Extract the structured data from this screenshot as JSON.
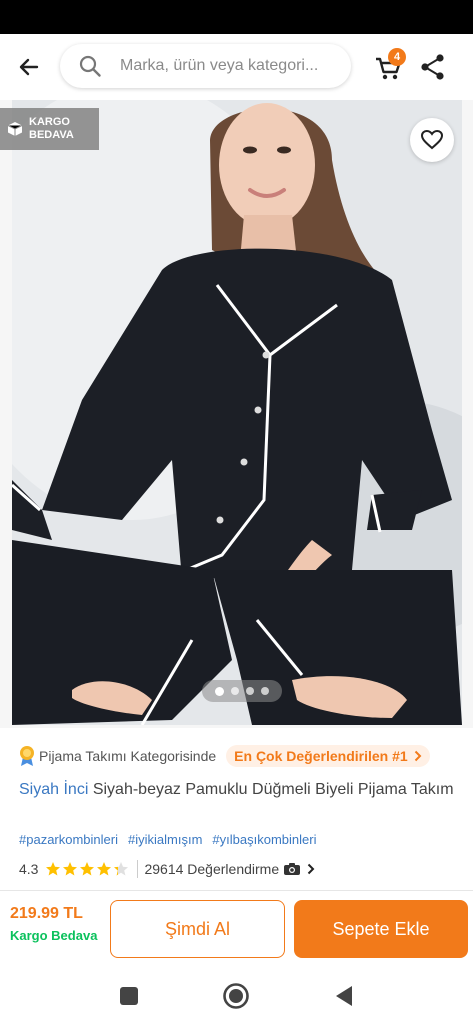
{
  "header": {
    "search_placeholder": "Marka, ürün veya kategori...",
    "cart_count": "4"
  },
  "badge": {
    "line1": "KARGO",
    "line2": "BEDAVA"
  },
  "gallery": {
    "image_count": 4,
    "active_index": 0
  },
  "category": {
    "label": "Pijama Takımı Kategorisinde",
    "rank": "En Çok Değerlendirilen #1"
  },
  "product": {
    "brand": "Siyah İnci",
    "name": "Siyah-beyaz Pamuklu Düğmeli Biyeli Pijama Takım",
    "tags": [
      "#pazarkombinleri",
      "#iyikialmışım",
      "#yılbaşıkombinleri"
    ]
  },
  "rating": {
    "value": "4.3",
    "stars": 4.3,
    "review_count": "29614 Değerlendirme"
  },
  "purchase": {
    "price": "219.99 TL",
    "shipping": "Kargo Bedava",
    "buy_now_label": "Şimdi Al",
    "add_to_cart_label": "Sepete Ekle"
  },
  "colors": {
    "accent": "#f27a1a",
    "link": "#3a78c2",
    "free_shipping": "#0bc15c"
  }
}
